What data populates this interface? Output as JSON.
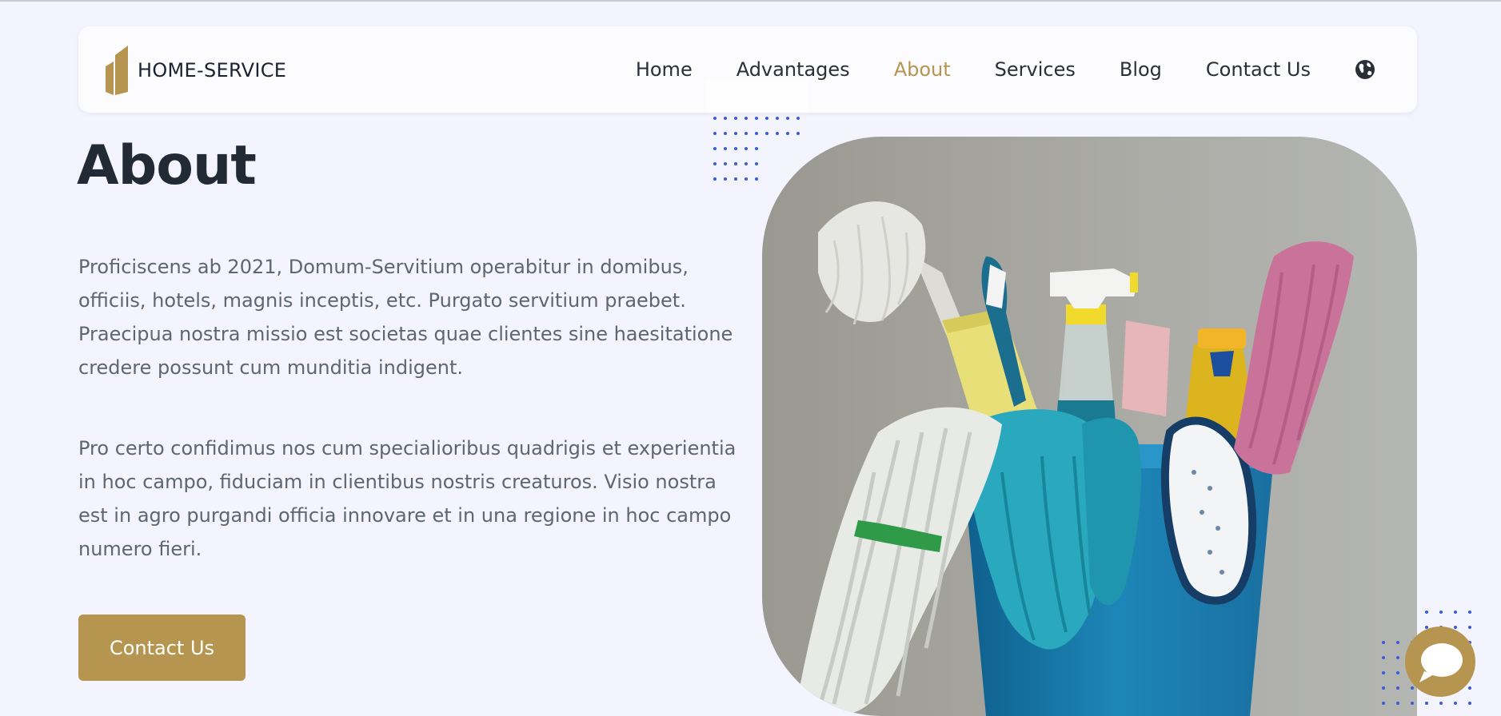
{
  "brand": {
    "name": "HOME-SERVICE",
    "logo_icon": "building-logo-icon"
  },
  "nav": {
    "items": [
      {
        "label": "Home",
        "active": false
      },
      {
        "label": "Advantages",
        "active": false
      },
      {
        "label": "About",
        "active": true
      },
      {
        "label": "Services",
        "active": false
      },
      {
        "label": "Blog",
        "active": false
      },
      {
        "label": "Contact Us",
        "active": false
      }
    ],
    "language_icon": "globe-icon"
  },
  "about": {
    "title": "About",
    "paragraph_1": "Proficiscens ab 2021, Domum-Servitium operabitur in domibus, officiis, hotels, magnis inceptis, etc. Purgato servitium praebet. Praecipua nostra missio est societas quae clientes sine haesitatione credere possunt cum munditia indigent.",
    "paragraph_2": "Pro certo confidimus nos cum specialioribus quadrigis et experientia in hoc campo, fiduciam in clientibus nostris creaturos. Visio nostra est in agro purgandi officia innovare et in una regione in hoc campo numero fieri.",
    "cta_label": "Contact Us"
  },
  "hero_image": {
    "subject": "cleaning-supplies-bucket"
  },
  "chat": {
    "icon": "chat-bubble-icon"
  },
  "colors": {
    "accent": "#b5954f",
    "background": "#f3f4fd",
    "dots": "#3b5bd6",
    "heading": "#222a36",
    "body_text": "#5d6671"
  }
}
